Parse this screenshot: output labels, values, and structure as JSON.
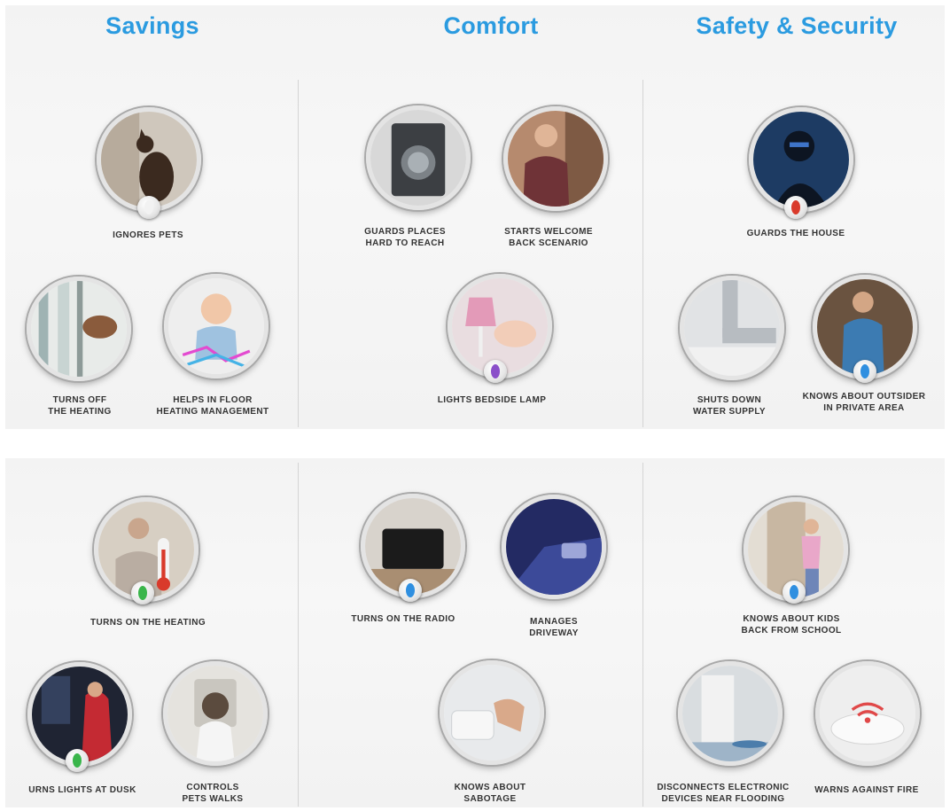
{
  "headings": {
    "savings": "Savings",
    "comfort": "Comfort",
    "safety": "Safety & Security"
  },
  "top": {
    "savings": [
      {
        "line1": "IGNORES PETS",
        "line2": ""
      },
      {
        "line1": "TURNS OFF",
        "line2": "THE HEATING"
      },
      {
        "line1": "HELPS IN FLOOR",
        "line2": "HEATING MANAGEMENT"
      }
    ],
    "comfort": [
      {
        "line1": "GUARDS PLACES",
        "line2": "HARD TO REACH"
      },
      {
        "line1": "STARTS WELCOME",
        "line2": "BACK SCENARIO"
      },
      {
        "line1": "LIGHTS BEDSIDE LAMP",
        "line2": ""
      }
    ],
    "safety": [
      {
        "line1": "GUARDS THE HOUSE",
        "line2": ""
      },
      {
        "line1": "SHUTS DOWN",
        "line2": "WATER SUPPLY"
      },
      {
        "line1": "KNOWS ABOUT OUTSIDER",
        "line2": "IN PRIVATE AREA"
      }
    ]
  },
  "bottom": {
    "savings": [
      {
        "line1": "TURNS ON THE HEATING",
        "line2": ""
      },
      {
        "line1": "URNS LIGHTS AT DUSK",
        "line2": ""
      },
      {
        "line1": "CONTROLS",
        "line2": "PETS WALKS"
      }
    ],
    "comfort": [
      {
        "line1": "TURNS ON THE RADIO",
        "line2": ""
      },
      {
        "line1": "MANAGES",
        "line2": "DRIVEWAY"
      },
      {
        "line1": "KNOWS ABOUT",
        "line2": "SABOTAGE"
      }
    ],
    "safety": [
      {
        "line1": "KNOWS ABOUT KIDS",
        "line2": "BACK FROM SCHOOL"
      },
      {
        "line1": "DISCONNECTS ELECTRONIC",
        "line2": "DEVICES NEAR FLOODING"
      },
      {
        "line1": "WARNS AGAINST FIRE",
        "line2": ""
      }
    ]
  },
  "sensor_colors": {
    "white": "#f2f2f2",
    "red": "#d93a2b",
    "purple": "#8a4fc9",
    "blue": "#2f8fe0",
    "green": "#39b54a"
  },
  "accent": "#2b9be0"
}
